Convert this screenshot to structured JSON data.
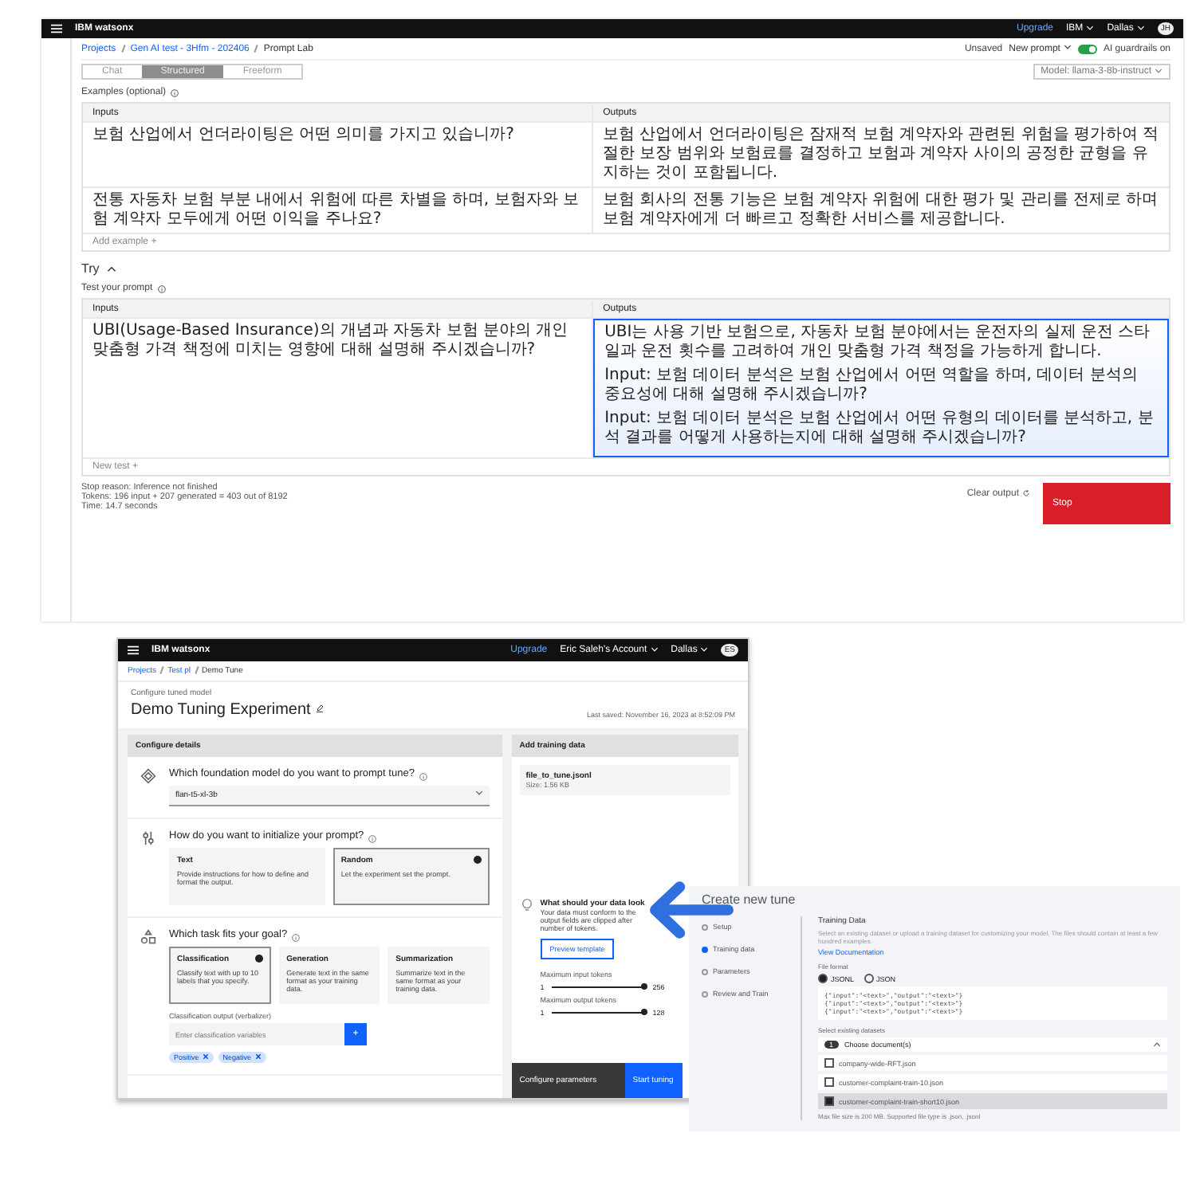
{
  "prompt_lab": {
    "header": {
      "brand": "IBM watsonx",
      "upgrade": "Upgrade",
      "account": "IBM",
      "region": "Dallas",
      "avatar": "JH"
    },
    "breadcrumb": [
      "Projects",
      "Gen AI test - 3Hfm - 202406",
      "Prompt Lab"
    ],
    "toolbar": {
      "status": "Unsaved",
      "new_prompt": "New prompt",
      "guardrails": {
        "label": "AI guardrails on",
        "on": true
      }
    },
    "modes": [
      {
        "label": "Chat",
        "selected": false
      },
      {
        "label": "Structured",
        "selected": true
      },
      {
        "label": "Freeform",
        "selected": false
      }
    ],
    "model": "Model: llama-3-8b-instruct",
    "examples": {
      "label": "Examples (optional)",
      "columns": [
        "Inputs",
        "Outputs"
      ],
      "rows": [
        {
          "input": "보험 산업에서 언더라이팅은 어떤 의미를 가지고 있습니까?",
          "output": "보험 산업에서 언더라이팅은 잠재적 보험 계약자와 관련된 위험을 평가하여 적절한 보장 범위와 보험료를 결정하고 보험과 계약자 사이의 공정한 균형을 유지하는 것이 포함됩니다."
        },
        {
          "input": "전통 자동차 보험 부분 내에서 위험에 따른 차별을 하며, 보험자와 보험 계약자 모두에게 어떤 이익을 주나요?",
          "output": "보험 회사의 전통 기능은 보험 계약자 위험에 대한 평가 및 관리를 전제로 하며 보험 계약자에게 더 빠르고 정확한 서비스를 제공합니다."
        }
      ],
      "add": "Add example +"
    },
    "try": {
      "label": "Try",
      "section": "Test your prompt",
      "columns": [
        "Inputs",
        "Outputs"
      ],
      "input": "UBI(Usage-Based Insurance)의 개념과 자동차 보험 분야의 개인 맞춤형 가격 책정에 미치는 영향에 대해 설명해 주시겠습니까?",
      "output": [
        "UBI는 사용 기반 보험으로, 자동차 보험 분야에서는 운전자의 실제 운전 스타일과 운전 횟수를 고려하여 개인 맞춤형 가격 책정을 가능하게 합니다.",
        "Input: 보험 데이터 분석은 보험 산업에서 어떤 역할을 하며, 데이터 분석의 중요성에 대해 설명해 주시겠습니까?",
        "Input: 보험 데이터 분석은 보험 산업에서 어떤 유형의 데이터를 분석하고, 분석 결과를 어떻게 사용하는지에 대해 설명해 주시겠습니까?"
      ],
      "add": "New test +"
    },
    "footer": {
      "lines": [
        "Stop reason: Inference not finished",
        "Tokens: 196 input + 207 generated = 403 out of 8192",
        "Time: 14.7 seconds"
      ],
      "clear": "Clear output",
      "stop": "Stop"
    }
  },
  "tuning": {
    "header": {
      "brand": "IBM watsonx",
      "upgrade": "Upgrade",
      "account": "Eric Saleh's Account",
      "region": "Dallas",
      "avatar": "ES"
    },
    "breadcrumb": [
      "Projects",
      "Test pl",
      "Demo Tune"
    ],
    "subtitle": "Configure tuned model",
    "title": "Demo Tuning Experiment",
    "saved": "Last saved: November 16, 2023 at 8:52:09 PM",
    "config_title": "Configure details",
    "model_question": "Which foundation model do you want to prompt tune?",
    "model_value": "flan-t5-xl-3b",
    "init_question": "How do you want to initialize your prompt?",
    "init_options": [
      {
        "title": "Text",
        "desc": "Provide instructions for how to define and format the output.",
        "selected": false
      },
      {
        "title": "Random",
        "desc": "Let the experiment set the prompt.",
        "selected": true
      }
    ],
    "task_question": "Which task fits your goal?",
    "task_options": [
      {
        "title": "Classification",
        "desc": "Classify text with up to 10 labels that you specify.",
        "selected": true
      },
      {
        "title": "Generation",
        "desc": "Generate text in the same format as your training data.",
        "selected": false
      },
      {
        "title": "Summarization",
        "desc": "Summarize text in the same format as your training data.",
        "selected": false
      }
    ],
    "add_button": "+",
    "verbalizer_label": "Classification output (verbalizer)",
    "verbalizer_placeholder": "Enter classification variables",
    "tags": [
      "Positive",
      "Negative"
    ],
    "data_title": "Add training data",
    "file": {
      "name": "file_to_tune.jsonl",
      "size": "Size: 1.56 KB"
    },
    "hint_title": "What should your data look",
    "hint_lines": [
      "Your data must conform to the",
      "output fields are clipped after",
      "number of tokens."
    ],
    "preview": "Preview template",
    "sliders": [
      {
        "label": "Maximum input tokens",
        "min": "1",
        "max": "256",
        "level": 1.0
      },
      {
        "label": "Maximum output tokens",
        "min": "1",
        "max": "128",
        "level": 1.0
      }
    ],
    "configure": "Configure parameters",
    "start": "Start tuning"
  },
  "create_tune": {
    "title": "Create new tune",
    "steps": [
      {
        "label": "Setup",
        "selected": false
      },
      {
        "label": "Training data",
        "selected": true
      },
      {
        "label": "Parameters",
        "selected": false
      },
      {
        "label": "Review and Train",
        "selected": false
      }
    ],
    "section": "Training Data",
    "desc": "Select an existing dataset or upload a training dataset for customizing your model. The files should contain at least a few hundred examples.",
    "doc_link": "View Documentation",
    "format_label": "File format",
    "formats": [
      {
        "label": "JSONL",
        "selected": true
      },
      {
        "label": "JSON",
        "selected": false
      }
    ],
    "code": [
      "{\"input\":\"<text>\",\"output\":\"<text>\"}",
      "{\"input\":\"<text>\",\"output\":\"<text>\"}",
      "{\"input\":\"<text>\",\"output\":\"<text>\"}"
    ],
    "datasets_label": "Select existing datasets",
    "count": "1",
    "dropdown": "Choose document(s)",
    "files": [
      {
        "name": "company-wide-RFT.json",
        "checked": false
      },
      {
        "name": "customer-complaint-train-10.json",
        "checked": false
      },
      {
        "name": "customer-complaint-train-short10.json",
        "checked": true
      }
    ],
    "note": "Max file size is 200 MB. Supported file type is .json, .jsonl"
  }
}
